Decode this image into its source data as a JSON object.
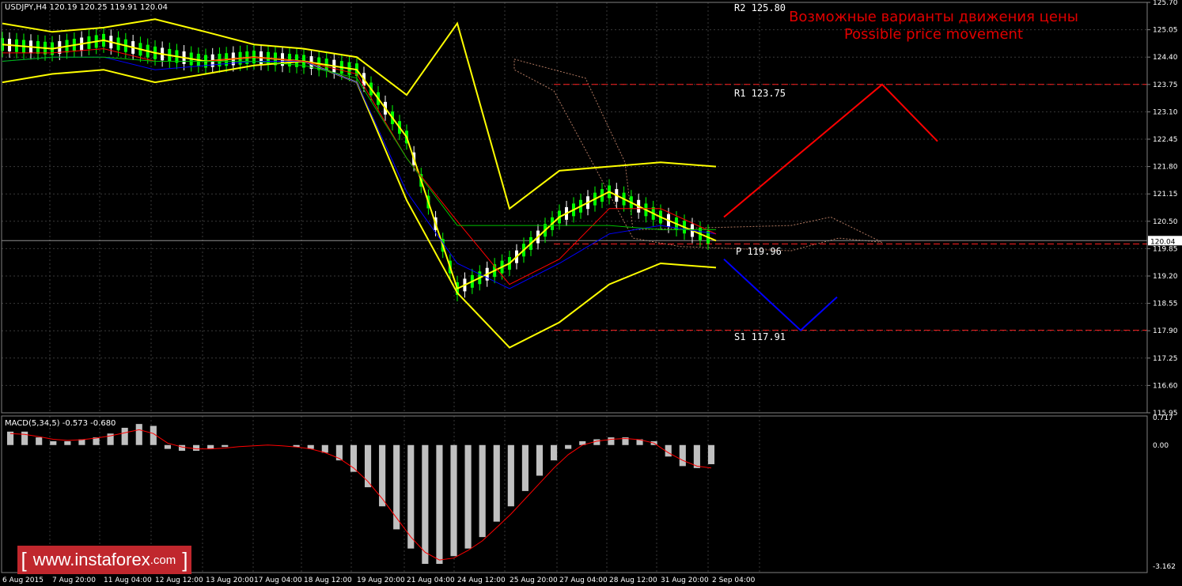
{
  "header": {
    "symbol_info": "USDJPY,H4  120.19 120.25 119.91 120.04",
    "macd_info": "MACD(5,34,5) -0.573 -0.680"
  },
  "title": {
    "line_ru": "Возможные варианты движения цены",
    "line_en": "Possible price movement"
  },
  "levels": {
    "r2": "R2 125.80",
    "r1": "R1 123.75",
    "p": "P 119.96",
    "s1": "S1 117.91"
  },
  "price_axis": [
    "125.70",
    "125.05",
    "124.40",
    "123.75",
    "123.10",
    "122.45",
    "121.80",
    "121.15",
    "120.50",
    "119.85",
    "119.20",
    "118.55",
    "117.90",
    "117.25",
    "116.60",
    "115.95"
  ],
  "current_price": "120.04",
  "macd_axis": [
    "0.717",
    "0.00",
    "-3.162"
  ],
  "time_axis": [
    "6 Aug 2015",
    "7 Aug 20:00",
    "11 Aug 04:00",
    "12 Aug 12:00",
    "13 Aug 20:00",
    "17 Aug 04:00",
    "18 Aug 12:00",
    "19 Aug 20:00",
    "21 Aug 04:00",
    "24 Aug 12:00",
    "25 Aug 20:00",
    "27 Aug 04:00",
    "28 Aug 12:00",
    "31 Aug 20:00",
    "2 Sep 04:00"
  ],
  "watermark": {
    "open": "[",
    "site": "www.instaforex",
    "tld": ".com",
    "close": "]"
  },
  "colors": {
    "bull": "#00ff00",
    "bear": "#ffffff",
    "bollinger": "#ffff00",
    "tenkan": "#0000ff",
    "kijun": "#ff0000",
    "chikou": "#00c000",
    "up_scenario": "#ff0000",
    "down_scenario": "#0000ff",
    "levels": "#ff2020"
  },
  "chart_data": {
    "type": "line",
    "symbol": "USDJPY",
    "timeframe": "H4",
    "ylim": [
      115.95,
      125.7
    ],
    "x": [
      "6 Aug 2015",
      "7 Aug 20:00",
      "11 Aug 04:00",
      "12 Aug 12:00",
      "13 Aug 20:00",
      "17 Aug 04:00",
      "18 Aug 12:00",
      "19 Aug 20:00",
      "21 Aug 04:00",
      "24 Aug 12:00",
      "25 Aug 20:00",
      "27 Aug 04:00",
      "28 Aug 12:00",
      "31 Aug 20:00",
      "2 Sep 04:00"
    ],
    "series": [
      {
        "values": [
          124.7,
          124.6,
          124.8,
          124.5,
          124.3,
          124.4,
          124.3,
          124.1,
          122.5,
          118.9,
          119.5,
          120.6,
          121.2,
          120.6,
          120.04
        ]
      },
      {
        "values": [
          125.2,
          125.0,
          125.1,
          125.3,
          125.0,
          124.7,
          124.6,
          124.4,
          123.5,
          125.2,
          120.8,
          121.7,
          121.8,
          121.9,
          121.8
        ]
      },
      {
        "values": [
          123.8,
          124.0,
          124.1,
          123.8,
          124.0,
          124.2,
          124.3,
          123.8,
          121.0,
          118.8,
          117.5,
          118.1,
          119.0,
          119.5,
          119.4
        ]
      },
      {
        "values": [
          124.3,
          124.4,
          124.4,
          124.1,
          124.2,
          124.3,
          124.3,
          123.8,
          121.2,
          119.5,
          118.9,
          119.5,
          120.2,
          120.4,
          120.2
        ]
      },
      {
        "values": [
          124.5,
          124.5,
          124.6,
          124.3,
          124.3,
          124.4,
          124.3,
          124.0,
          122.0,
          120.5,
          119.0,
          119.6,
          120.8,
          120.8,
          120.2
        ]
      },
      {
        "values": [
          124.3,
          124.4,
          124.4,
          124.3,
          124.3,
          124.3,
          124.2,
          123.9,
          122.0,
          120.4,
          120.4,
          120.4,
          120.4,
          120.3,
          120.3
        ]
      }
    ],
    "levels": [
      {
        "value": 125.8
      },
      {
        "value": 123.75
      },
      {
        "value": 119.96
      },
      {
        "value": 117.91
      }
    ],
    "scenarios": [
      {
        "points": [
          [
            120.6
          ],
          [
            123.75
          ],
          [
            122.4
          ]
        ]
      },
      {
        "points": [
          [
            119.6
          ],
          [
            117.91
          ],
          [
            118.7
          ]
        ]
      }
    ],
    "macd": {
      "ylim": [
        -3.162,
        0.717
      ],
      "hist": [
        0.35,
        0.35,
        0.2,
        0.1,
        0.1,
        0.15,
        0.2,
        0.3,
        0.45,
        0.55,
        0.5,
        -0.1,
        -0.15,
        -0.15,
        -0.1,
        -0.05,
        0.0,
        0.0,
        0.0,
        0.0,
        -0.05,
        -0.1,
        -0.2,
        -0.4,
        -0.7,
        -1.1,
        -1.6,
        -2.2,
        -2.7,
        -3.1,
        -3.1,
        -2.9,
        -2.7,
        -2.4,
        -2.0,
        -1.6,
        -1.2,
        -0.8,
        -0.4,
        -0.1,
        0.1,
        0.15,
        0.2,
        0.2,
        0.15,
        0.1,
        -0.3,
        -0.55,
        -0.6,
        -0.5
      ],
      "signal": [
        0.3,
        0.28,
        0.22,
        0.15,
        0.12,
        0.14,
        0.18,
        0.24,
        0.32,
        0.4,
        0.3,
        0.05,
        -0.05,
        -0.1,
        -0.1,
        -0.08,
        -0.04,
        -0.02,
        0.0,
        -0.02,
        -0.05,
        -0.1,
        -0.2,
        -0.35,
        -0.6,
        -0.95,
        -1.4,
        -1.9,
        -2.4,
        -2.8,
        -3.0,
        -2.95,
        -2.75,
        -2.5,
        -2.15,
        -1.8,
        -1.4,
        -1.0,
        -0.6,
        -0.25,
        0.0,
        0.1,
        0.15,
        0.17,
        0.14,
        0.05,
        -0.2,
        -0.4,
        -0.55,
        -0.6
      ]
    }
  }
}
